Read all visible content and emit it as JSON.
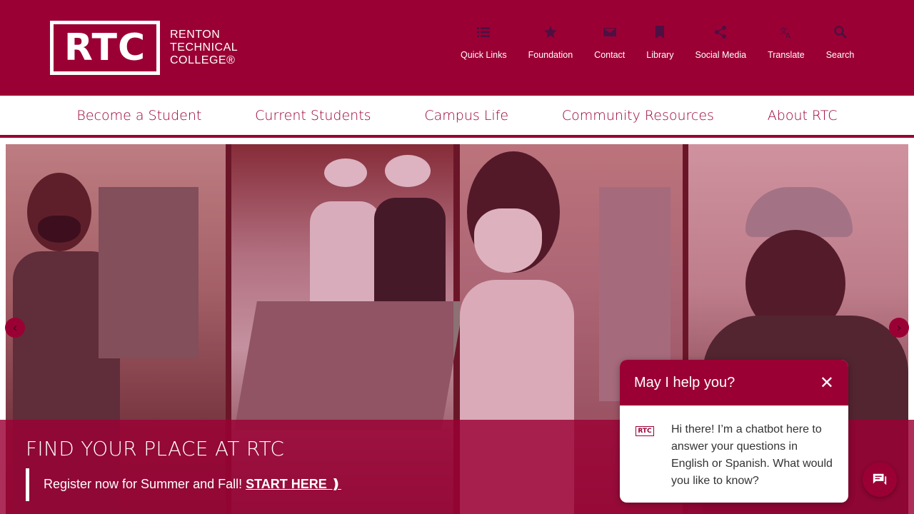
{
  "logo": {
    "abbr": "RTC",
    "name": "RENTON TECHNICAL COLLEGE®"
  },
  "utility_nav": [
    {
      "label": "Quick Links",
      "icon": "list-icon"
    },
    {
      "label": "Foundation",
      "icon": "star-icon"
    },
    {
      "label": "Contact",
      "icon": "envelope-icon"
    },
    {
      "label": "Library",
      "icon": "bookmark-icon"
    },
    {
      "label": "Social Media",
      "icon": "share-icon"
    },
    {
      "label": "Translate",
      "icon": "translate-icon"
    },
    {
      "label": "Search",
      "icon": "search-icon"
    }
  ],
  "main_nav": [
    "Become a Student",
    "Current Students",
    "Campus Life",
    "Community Resources",
    "About RTC"
  ],
  "hero": {
    "title": "FIND YOUR PLACE AT RTC",
    "text": "Register now for Summer and Fall!",
    "link": "START HERE ❫"
  },
  "chat": {
    "title": "May I help you?",
    "close": "✕",
    "avatar": "RTC",
    "message": "Hi there! I’m a chatbot here to answer your questions in English or Spanish. What would you like to know?"
  },
  "colors": {
    "brand": "#9b0034",
    "white": "#ffffff"
  }
}
